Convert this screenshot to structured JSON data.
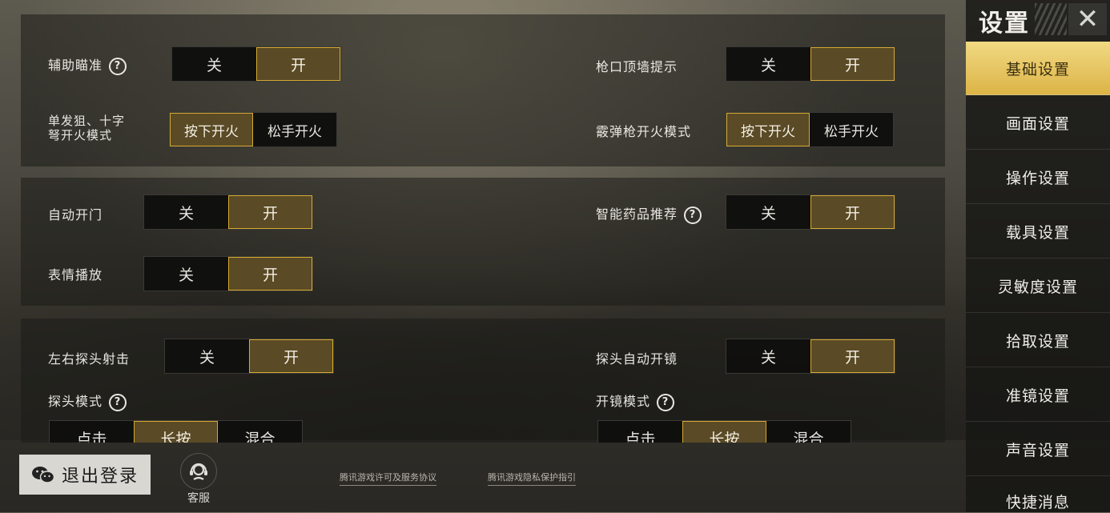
{
  "sidebar": {
    "title": "设置",
    "items": [
      {
        "label": "基础设置",
        "active": true
      },
      {
        "label": "画面设置",
        "active": false
      },
      {
        "label": "操作设置",
        "active": false
      },
      {
        "label": "载具设置",
        "active": false
      },
      {
        "label": "灵敏度设置",
        "active": false
      },
      {
        "label": "拾取设置",
        "active": false
      },
      {
        "label": "准镜设置",
        "active": false
      },
      {
        "label": "声音设置",
        "active": false
      },
      {
        "label": "快捷消息",
        "active": false
      }
    ]
  },
  "panel1": {
    "aim_assist": {
      "label": "辅助瞄准",
      "off": "关",
      "on": "开",
      "selected": "开"
    },
    "muzzle_hint": {
      "label": "枪口顶墙提示",
      "off": "关",
      "on": "开",
      "selected": "开"
    },
    "sniper_fire": {
      "label_line1": "单发狙、十字",
      "label_line2": "弩开火模式",
      "opt1": "按下开火",
      "opt2": "松手开火",
      "selected": "按下开火"
    },
    "shotgun_fire": {
      "label": "霰弹枪开火模式",
      "opt1": "按下开火",
      "opt2": "松手开火",
      "selected": "按下开火"
    }
  },
  "panel2": {
    "auto_door": {
      "label": "自动开门",
      "off": "关",
      "on": "开",
      "selected": "开"
    },
    "smart_meds": {
      "label": "智能药品推荐",
      "off": "关",
      "on": "开",
      "selected": "开"
    },
    "emote_play": {
      "label": "表情播放",
      "off": "关",
      "on": "开",
      "selected": "开"
    }
  },
  "panel3": {
    "peek_fire": {
      "label": "左右探头射击",
      "off": "关",
      "on": "开",
      "selected": "开"
    },
    "peek_scope": {
      "label": "探头自动开镜",
      "off": "关",
      "on": "开",
      "selected": "开"
    },
    "peek_mode": {
      "label": "探头模式",
      "opts": [
        "点击",
        "长按",
        "混合"
      ],
      "selected": "长按"
    },
    "scope_mode": {
      "label": "开镜模式",
      "opts": [
        "点击",
        "长按",
        "混合"
      ],
      "selected": "长按"
    }
  },
  "footer": {
    "logout": "退出登录",
    "customer_service": "客服",
    "license_link": "腾讯游戏许可及服务协议",
    "privacy_link": "腾讯游戏隐私保护指引"
  },
  "colors": {
    "accent": "#d6a933",
    "active_nav": "#e6c25a"
  }
}
